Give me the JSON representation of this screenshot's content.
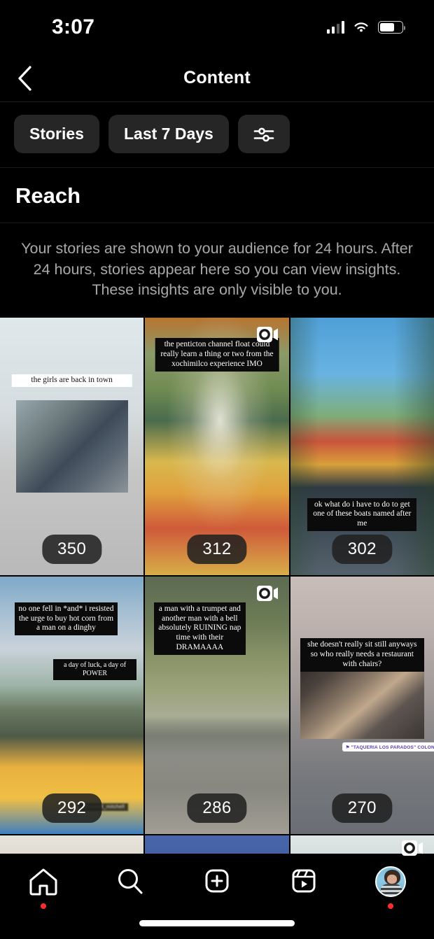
{
  "status_bar": {
    "time": "3:07",
    "signal_icon": "cellular-signal-icon",
    "wifi_icon": "wifi-icon",
    "battery_icon": "battery-icon"
  },
  "header": {
    "title": "Content",
    "back_icon": "chevron-left-icon"
  },
  "filters": {
    "content_type": "Stories",
    "date_range": "Last 7 Days",
    "settings_icon": "sliders-icon"
  },
  "section": {
    "title": "Reach",
    "description": "Your stories are shown to your audience for 24 hours. After 24 hours, stories appear here so you can view insights. These insights are only visible to you."
  },
  "stories": [
    {
      "reach": "350",
      "is_video": false,
      "overlay_text": "the girls are back in town",
      "overlay_style": "light"
    },
    {
      "reach": "312",
      "is_video": true,
      "overlay_text": "the penticton channel float could really learn a thing or two from the xochimilco experience IMO",
      "overlay_style": "dark"
    },
    {
      "reach": "302",
      "is_video": false,
      "overlay_text": "ok what do i have to do to get one of these boats named after me",
      "overlay_style": "dark"
    },
    {
      "reach": "292",
      "is_video": false,
      "overlay_text": "no one fell in *and* i resisted the urge to buy hot corn from a man on a dinghy",
      "overlay_text_2": "a day of luck, a day of POWER",
      "overlay_style": "dark",
      "user_tag": "@russell_mitchell"
    },
    {
      "reach": "286",
      "is_video": true,
      "overlay_text": "a man with a trumpet and another man with a bell absolutely RUINING nap time with their DRAMAAAA",
      "overlay_style": "dark"
    },
    {
      "reach": "270",
      "is_video": false,
      "overlay_text": "she doesn't really sit still anyways so who really needs a restaurant with chairs?",
      "overlay_style": "dark",
      "location_tag": "⚑ \"TAQUERIA LOS PARADOS\" COLONIA RO..."
    }
  ],
  "stories_partial_row": [
    {
      "is_video": false
    },
    {
      "is_video": false
    },
    {
      "is_video": true
    }
  ],
  "tabbar": [
    {
      "name": "home",
      "icon": "home-icon",
      "has_badge": true
    },
    {
      "name": "search",
      "icon": "search-icon",
      "has_badge": false
    },
    {
      "name": "create",
      "icon": "plus-square-icon",
      "has_badge": false
    },
    {
      "name": "reels",
      "icon": "reels-icon",
      "has_badge": false
    },
    {
      "name": "profile",
      "icon": "profile-avatar-icon",
      "has_badge": true
    }
  ],
  "colors": {
    "background": "#000000",
    "chip_bg": "#262626",
    "badge_bg": "rgba(32,32,32,0.86)",
    "secondary_text": "#a8a8a8",
    "notification_red": "#ff2d2d"
  }
}
